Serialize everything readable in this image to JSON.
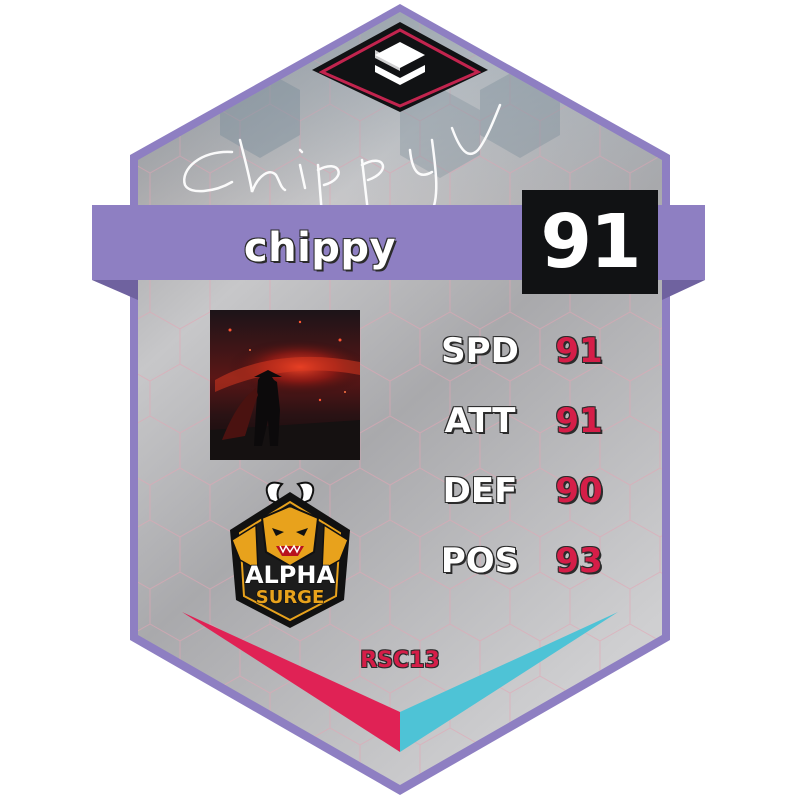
{
  "card": {
    "signature": "chippy",
    "player_name": "chippy",
    "overall_rating": "91",
    "stats": [
      {
        "label": "SPD",
        "value": "91"
      },
      {
        "label": "ATT",
        "value": "91"
      },
      {
        "label": "DEF",
        "value": "90"
      },
      {
        "label": "POS",
        "value": "93"
      }
    ],
    "team_logo_text": [
      "ALPHA",
      "SURGE"
    ],
    "footer": "RSC13"
  },
  "icons": {
    "top_badge": "layered-chevrons-icon",
    "avatar": "samurai-silhouette-image",
    "team_logo": "alpha-surge-oni-mask-logo"
  },
  "colors": {
    "frame": "#8e7fc2",
    "card_bg": "#b9b9bc",
    "rating_box": "#111214",
    "stat_value": "#d51e48",
    "accent_pink": "#e02255",
    "accent_cyan": "#4ec3d6",
    "team_gold": "#e8a21c"
  }
}
